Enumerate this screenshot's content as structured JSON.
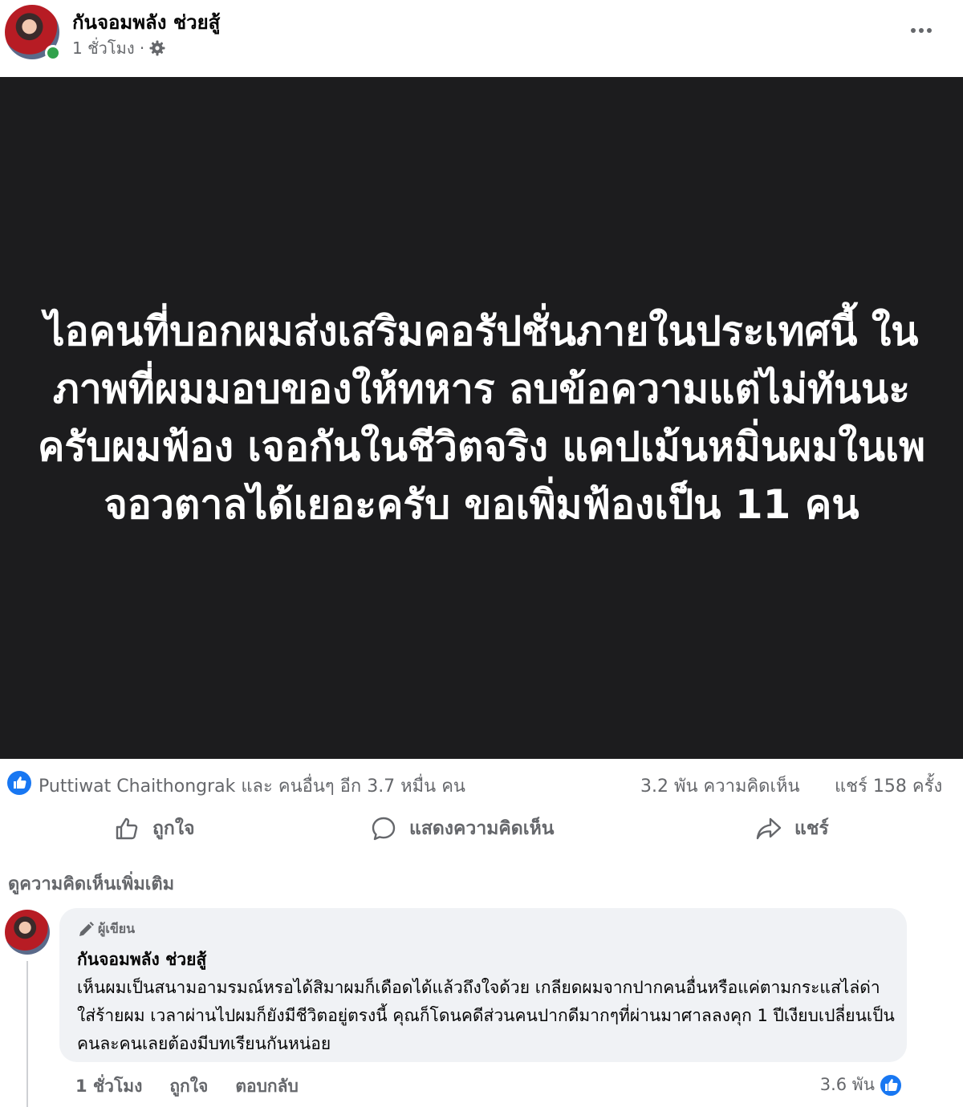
{
  "post": {
    "author": "กันจอมพลัง ช่วยสู้",
    "time": "1 ชั่วโมง ·",
    "text": "ไอคนที่บอกผมส่งเสริมคอรัปชั่นภายในประเทศนี้ ในภาพที่ผมมอบของให้ทหาร ลบข้อความแต่ไม่ทันนะครับผมฟ้อง เจอกันในชีวิตจริง แคปเม้นหมิ่นผมในเพจอวตาลได้เยอะครับ ขอเพิ่มฟ้องเป็น 11 คน",
    "background_color": "#1c1c1e"
  },
  "stats": {
    "reactors": "Puttiwat Chaithongrak และ คนอื่นๆ อีก 3.7 หมื่น คน",
    "comments": "3.2 พัน ความคิดเห็น",
    "shares": "แชร์ 158 ครั้ง"
  },
  "actions": {
    "like": "ถูกใจ",
    "comment": "แสดงความคิดเห็น",
    "share": "แชร์"
  },
  "comments_section": {
    "view_more": "ดูความคิดเห็นเพิ่มเติม",
    "comment": {
      "badge": "ผู้เขียน",
      "author": "กันจอมพลัง ช่วยสู้",
      "text": "เห็นผมเป็นสนามอามรมณ์หรอได้สิมาผมก็เดือดได้แล้วถึงใจด้วย เกลียดผมจากปากคนอื่นหรือแค่ตามกระแสไล่ด่าใส่ร้ายผม เวลาผ่านไปผมก็ยังมีชีวิตอยู่ตรงนี้ คุณก็โดนคดีส่วนคนปากดีมากๆที่ผ่านมาศาลลงคุก 1 ปีเงียบเปลี่ยนเป็นคนละคนเลยต้องมีบทเรียนกันหน่อย",
      "time": "1 ชั่วโมง",
      "like_label": "ถูกใจ",
      "reply_label": "ตอบกลับ",
      "reaction_count": "3.6 พัน"
    }
  },
  "colors": {
    "accent_blue": "#1877f2",
    "online_green": "#31a24c",
    "meta_gray": "#65676b",
    "bubble_gray": "#f0f2f5"
  }
}
